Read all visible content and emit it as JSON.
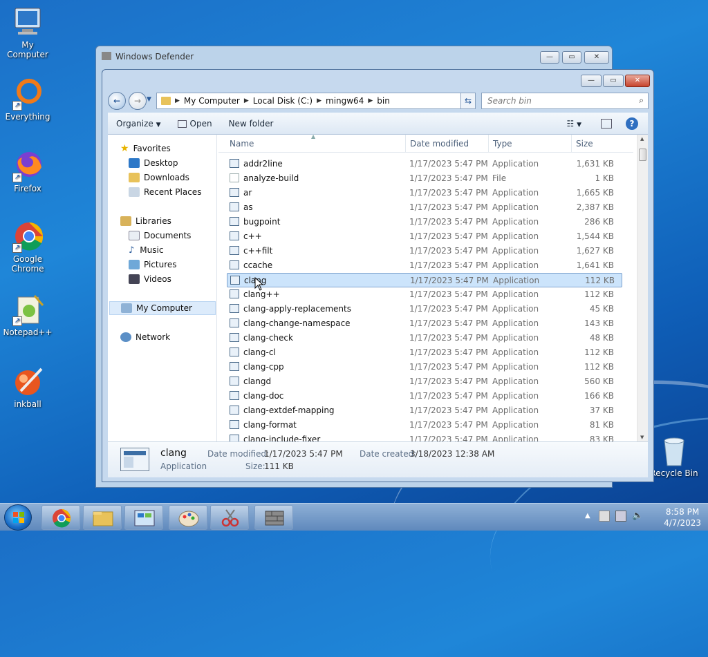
{
  "desktop": {
    "icons": [
      {
        "label": "My Computer"
      },
      {
        "label": "Everything"
      },
      {
        "label": "Firefox"
      },
      {
        "label": "Google Chrome"
      },
      {
        "label": "Notepad++"
      },
      {
        "label": "inkball"
      },
      {
        "label": "Recycle Bin"
      }
    ]
  },
  "bg_window": {
    "title": "Windows Defender"
  },
  "explorer": {
    "breadcrumb": [
      "My Computer",
      "Local Disk (C:)",
      "mingw64",
      "bin"
    ],
    "search_placeholder": "Search bin",
    "toolbar": {
      "organize": "Organize",
      "open": "Open",
      "new_folder": "New folder"
    },
    "nav": {
      "favorites": "Favorites",
      "desktop": "Desktop",
      "downloads": "Downloads",
      "recent": "Recent Places",
      "libraries": "Libraries",
      "documents": "Documents",
      "music": "Music",
      "pictures": "Pictures",
      "videos": "Videos",
      "my_computer": "My Computer",
      "network": "Network"
    },
    "columns": {
      "name": "Name",
      "date": "Date modified",
      "type": "Type",
      "size": "Size"
    },
    "files": [
      {
        "name": "addr2line",
        "date": "1/17/2023 5:47 PM",
        "type": "Application",
        "size": "1,631 KB"
      },
      {
        "name": "analyze-build",
        "date": "1/17/2023 5:47 PM",
        "type": "File",
        "size": "1 KB"
      },
      {
        "name": "ar",
        "date": "1/17/2023 5:47 PM",
        "type": "Application",
        "size": "1,665 KB"
      },
      {
        "name": "as",
        "date": "1/17/2023 5:47 PM",
        "type": "Application",
        "size": "2,387 KB"
      },
      {
        "name": "bugpoint",
        "date": "1/17/2023 5:47 PM",
        "type": "Application",
        "size": "286 KB"
      },
      {
        "name": "c++",
        "date": "1/17/2023 5:47 PM",
        "type": "Application",
        "size": "1,544 KB"
      },
      {
        "name": "c++filt",
        "date": "1/17/2023 5:47 PM",
        "type": "Application",
        "size": "1,627 KB"
      },
      {
        "name": "ccache",
        "date": "1/17/2023 5:47 PM",
        "type": "Application",
        "size": "1,641 KB"
      },
      {
        "name": "clang",
        "date": "1/17/2023 5:47 PM",
        "type": "Application",
        "size": "112 KB"
      },
      {
        "name": "clang++",
        "date": "1/17/2023 5:47 PM",
        "type": "Application",
        "size": "112 KB"
      },
      {
        "name": "clang-apply-replacements",
        "date": "1/17/2023 5:47 PM",
        "type": "Application",
        "size": "45 KB"
      },
      {
        "name": "clang-change-namespace",
        "date": "1/17/2023 5:47 PM",
        "type": "Application",
        "size": "143 KB"
      },
      {
        "name": "clang-check",
        "date": "1/17/2023 5:47 PM",
        "type": "Application",
        "size": "48 KB"
      },
      {
        "name": "clang-cl",
        "date": "1/17/2023 5:47 PM",
        "type": "Application",
        "size": "112 KB"
      },
      {
        "name": "clang-cpp",
        "date": "1/17/2023 5:47 PM",
        "type": "Application",
        "size": "112 KB"
      },
      {
        "name": "clangd",
        "date": "1/17/2023 5:47 PM",
        "type": "Application",
        "size": "560 KB"
      },
      {
        "name": "clang-doc",
        "date": "1/17/2023 5:47 PM",
        "type": "Application",
        "size": "166 KB"
      },
      {
        "name": "clang-extdef-mapping",
        "date": "1/17/2023 5:47 PM",
        "type": "Application",
        "size": "37 KB"
      },
      {
        "name": "clang-format",
        "date": "1/17/2023 5:47 PM",
        "type": "Application",
        "size": "81 KB"
      },
      {
        "name": "clang-include-fixer",
        "date": "1/17/2023 5:47 PM",
        "type": "Application",
        "size": "83 KB"
      }
    ],
    "selected_index": 8,
    "details": {
      "name": "clang",
      "type": "Application",
      "date_modified_label": "Date modified:",
      "date_modified": "1/17/2023 5:47 PM",
      "date_created_label": "Date created:",
      "date_created": "3/18/2023 12:38 AM",
      "size_label": "Size:",
      "size": "111 KB"
    }
  },
  "taskbar": {
    "time": "8:58 PM",
    "date": "4/7/2023"
  },
  "colors": {
    "selection": "#cce4fb",
    "accent": "#1f86d8"
  }
}
